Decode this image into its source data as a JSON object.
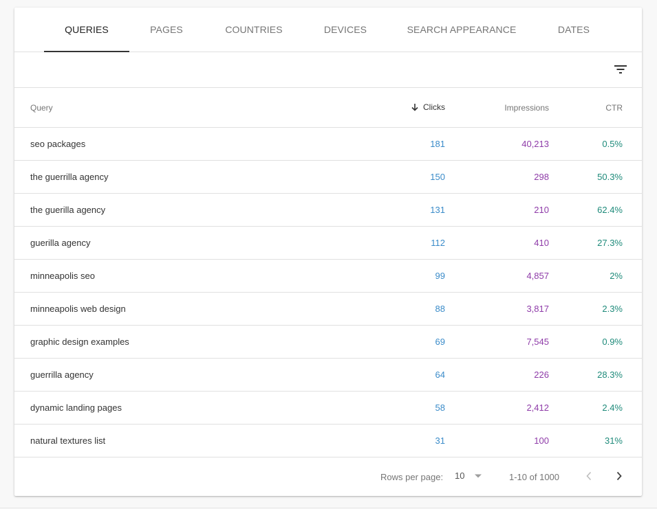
{
  "tabs": [
    {
      "label": "QUERIES",
      "active": true
    },
    {
      "label": "PAGES",
      "active": false
    },
    {
      "label": "COUNTRIES",
      "active": false
    },
    {
      "label": "DEVICES",
      "active": false
    },
    {
      "label": "SEARCH APPEARANCE",
      "active": false
    },
    {
      "label": "DATES",
      "active": false
    }
  ],
  "toolbar": {
    "filter_icon": "filter-list-icon"
  },
  "table": {
    "columns": {
      "query": "Query",
      "clicks": "Clicks",
      "impressions": "Impressions",
      "ctr": "CTR"
    },
    "sort": {
      "column": "clicks",
      "direction": "descending",
      "icon": "arrow-down-icon"
    },
    "rows": [
      {
        "query": "seo packages",
        "clicks": "181",
        "impressions": "40,213",
        "ctr": "0.5%"
      },
      {
        "query": "the guerrilla agency",
        "clicks": "150",
        "impressions": "298",
        "ctr": "50.3%"
      },
      {
        "query": "the guerilla agency",
        "clicks": "131",
        "impressions": "210",
        "ctr": "62.4%"
      },
      {
        "query": "guerilla agency",
        "clicks": "112",
        "impressions": "410",
        "ctr": "27.3%"
      },
      {
        "query": "minneapolis seo",
        "clicks": "99",
        "impressions": "4,857",
        "ctr": "2%"
      },
      {
        "query": "minneapolis web design",
        "clicks": "88",
        "impressions": "3,817",
        "ctr": "2.3%"
      },
      {
        "query": "graphic design examples",
        "clicks": "69",
        "impressions": "7,545",
        "ctr": "0.9%"
      },
      {
        "query": "guerrilla agency",
        "clicks": "64",
        "impressions": "226",
        "ctr": "28.3%"
      },
      {
        "query": "dynamic landing pages",
        "clicks": "58",
        "impressions": "2,412",
        "ctr": "2.4%"
      },
      {
        "query": "natural textures list",
        "clicks": "31",
        "impressions": "100",
        "ctr": "31%"
      }
    ]
  },
  "pagination": {
    "rows_per_page_label": "Rows per page:",
    "rows_per_page_value": "10",
    "range_text": "1-10 of 1000",
    "prev_enabled": false,
    "next_enabled": true
  },
  "colors": {
    "clicks": "#3a8bc9",
    "impressions": "#8e3ba8",
    "ctr": "#1e8a7a",
    "active_tab_indicator": "#333333"
  }
}
